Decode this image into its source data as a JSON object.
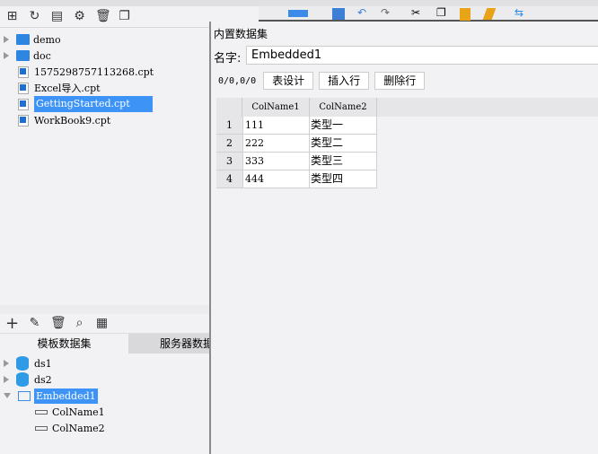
{
  "toolbar_left": {
    "icons": [
      "new-folder-icon",
      "refresh-icon",
      "open-icon",
      "settings-icon",
      "delete-icon",
      "copy-icon"
    ]
  },
  "toolbar_right": {
    "icons": [
      "menu-icon",
      "save-icon",
      "undo-icon",
      "redo-icon",
      "cut-icon",
      "copy-icon",
      "paste-icon",
      "format-brush-icon",
      "swap-icon"
    ]
  },
  "file_tree": [
    {
      "label": "demo",
      "type": "folder"
    },
    {
      "label": "doc",
      "type": "folder"
    },
    {
      "label": "1575298757113268.cpt",
      "type": "file"
    },
    {
      "label": "Excel导入.cpt",
      "type": "file"
    },
    {
      "label": "GettingStarted.cpt",
      "type": "file",
      "selected": true
    },
    {
      "label": "WorkBook9.cpt",
      "type": "file"
    }
  ],
  "dataset_tabs": [
    {
      "label": "模板数据集",
      "active": true
    },
    {
      "label": "服务器数据集"
    }
  ],
  "dataset_tree": {
    "ds1": "ds1",
    "ds2": "ds2",
    "embedded": "Embedded1",
    "cols": [
      "ColName1",
      "ColName2"
    ]
  },
  "dialog": {
    "title": "内置数据集",
    "name_label": "名字:",
    "name_value": "Embedded1",
    "position": "0/0,0/0",
    "buttons": [
      "表设计",
      "插入行",
      "删除行"
    ],
    "columns": [
      "ColName1",
      "ColName2"
    ],
    "rows": [
      [
        "1",
        "111",
        "类型一"
      ],
      [
        "2",
        "222",
        "类型二"
      ],
      [
        "3",
        "333",
        "类型三"
      ],
      [
        "4",
        "444",
        "类型四"
      ]
    ]
  }
}
